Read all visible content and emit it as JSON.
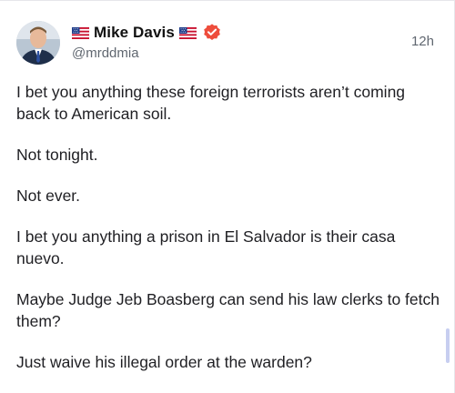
{
  "post": {
    "author": {
      "display_name": "Mike Davis",
      "handle": "@mrddmia",
      "verified": true,
      "name_flags": [
        "us-flag-icon",
        "us-flag-icon"
      ]
    },
    "timestamp": "12h",
    "paragraphs": [
      "I bet you anything these foreign terrorists aren’t coming back to American soil.",
      "Not tonight.",
      "Not ever.",
      "I bet you anything a prison in El Salvador is their casa nuevo.",
      "Maybe Judge Jeb Boasberg can send his law clerks to fetch them?",
      "Just waive his illegal order at the warden?"
    ]
  },
  "colors": {
    "verified_badge": "#ee4d3c",
    "text_primary": "#1f1f23",
    "text_secondary": "#606770",
    "scrollbar": "#c7cef0"
  }
}
